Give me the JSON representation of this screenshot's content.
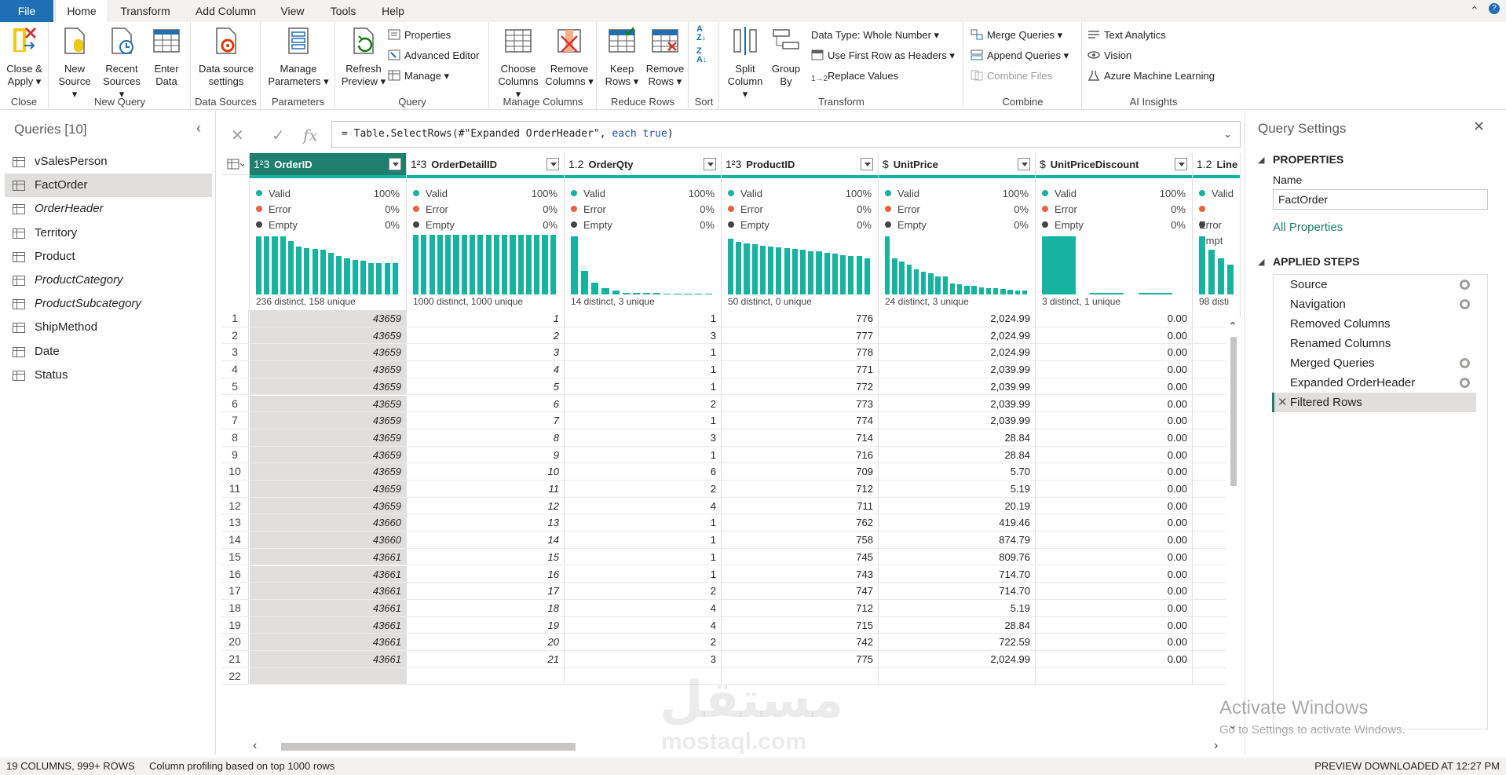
{
  "tabs": [
    "File",
    "Home",
    "Transform",
    "Add Column",
    "View",
    "Tools",
    "Help"
  ],
  "ribbon": {
    "groups": {
      "close": "Close",
      "new_query": "New Query",
      "data_sources": "Data Sources",
      "parameters": "Parameters",
      "query": "Query",
      "manage_columns": "Manage Columns",
      "reduce_rows": "Reduce Rows",
      "sort": "Sort",
      "transform": "Transform",
      "combine": "Combine",
      "ai_insights": "AI Insights"
    },
    "close_apply": [
      "Close &",
      "Apply ▾"
    ],
    "new_source": [
      "New",
      "Source ▾"
    ],
    "recent_sources": [
      "Recent",
      "Sources ▾"
    ],
    "enter_data": [
      "Enter",
      "Data"
    ],
    "data_source_settings": [
      "Data source",
      "settings"
    ],
    "manage_parameters": [
      "Manage",
      "Parameters ▾"
    ],
    "refresh_preview": [
      "Refresh",
      "Preview ▾"
    ],
    "properties": "Properties",
    "advanced_editor": "Advanced Editor",
    "manage": "Manage ▾",
    "choose_columns": [
      "Choose",
      "Columns ▾"
    ],
    "remove_columns": [
      "Remove",
      "Columns ▾"
    ],
    "keep_rows": [
      "Keep",
      "Rows ▾"
    ],
    "remove_rows": [
      "Remove",
      "Rows ▾"
    ],
    "split_column": [
      "Split",
      "Column ▾"
    ],
    "group_by": [
      "Group",
      "By"
    ],
    "data_type": "Data Type: Whole Number ▾",
    "use_first_row": "Use First Row as Headers ▾",
    "replace_values": "Replace Values",
    "merge_queries": "Merge Queries ▾",
    "append_queries": "Append Queries ▾",
    "combine_files": "Combine Files",
    "text_analytics": "Text Analytics",
    "vision": "Vision",
    "azure_ml": "Azure Machine Learning"
  },
  "queries": {
    "title": "Queries [10]",
    "items": [
      {
        "name": "vSalesPerson",
        "italic": false
      },
      {
        "name": "FactOrder",
        "italic": false,
        "selected": true
      },
      {
        "name": "OrderHeader",
        "italic": true
      },
      {
        "name": "Territory",
        "italic": false
      },
      {
        "name": "Product",
        "italic": false
      },
      {
        "name": "ProductCategory",
        "italic": true
      },
      {
        "name": "ProductSubcategory",
        "italic": true
      },
      {
        "name": "ShipMethod",
        "italic": false
      },
      {
        "name": "Date",
        "italic": false
      },
      {
        "name": "Status",
        "italic": false
      }
    ]
  },
  "formula": {
    "prefix": "= Table.SelectRows(#\"Expanded OrderHeader\", ",
    "kw": "each true",
    "suffix": ")"
  },
  "columns": [
    {
      "type": "1²3",
      "name": "OrderID",
      "valid": "100%",
      "error": "0%",
      "empty": "0%",
      "footer": "236 distinct, 158 unique",
      "hist": [
        0.98,
        0.98,
        0.98,
        0.98,
        0.9,
        0.8,
        0.78,
        0.76,
        0.75,
        0.7,
        0.65,
        0.6,
        0.58,
        0.56,
        0.53,
        0.52,
        0.52,
        0.52
      ]
    },
    {
      "type": "1²3",
      "name": "OrderDetailID",
      "valid": "100%",
      "error": "0%",
      "empty": "0%",
      "footer": "1000 distinct, 1000 unique",
      "hist": [
        1,
        1,
        1,
        1,
        1,
        1,
        1,
        1,
        1,
        1,
        1,
        1,
        1,
        1,
        1,
        1,
        1,
        1
      ]
    },
    {
      "type": "1.2",
      "name": "OrderQty",
      "valid": "100%",
      "error": "0%",
      "empty": "0%",
      "footer": "14 distinct, 3 unique",
      "hist": [
        0.98,
        0.4,
        0.2,
        0.1,
        0.06,
        0.03,
        0.02,
        0.02,
        0.02,
        0.01,
        0.01,
        0.01,
        0.01,
        0.01
      ]
    },
    {
      "type": "1²3",
      "name": "ProductID",
      "valid": "100%",
      "error": "0%",
      "empty": "0%",
      "footer": "50 distinct, 0 unique",
      "hist": [
        0.93,
        0.88,
        0.85,
        0.84,
        0.82,
        0.8,
        0.79,
        0.78,
        0.76,
        0.75,
        0.73,
        0.72,
        0.7,
        0.69,
        0.66,
        0.65,
        0.64,
        0.6
      ]
    },
    {
      "type": "$",
      "name": "UnitPrice",
      "valid": "100%",
      "error": "0%",
      "empty": "0%",
      "footer": "24 distinct, 3 unique",
      "hist": [
        0.98,
        0.6,
        0.55,
        0.5,
        0.42,
        0.38,
        0.35,
        0.3,
        0.3,
        0.18,
        0.17,
        0.15,
        0.14,
        0.12,
        0.11,
        0.1,
        0.09,
        0.08,
        0.07,
        0.06
      ]
    },
    {
      "type": "$",
      "name": "UnitPriceDiscount",
      "valid": "100%",
      "error": "0%",
      "empty": "0%",
      "footer": "3 distinct, 1 unique",
      "hist": [
        0.98,
        0.02,
        0.02
      ]
    },
    {
      "type": "1.2",
      "name": "Line",
      "valid": "Valid",
      "error": "Error",
      "empty": "Empt",
      "footer": "98 disti",
      "hist": [
        0.98,
        0.75,
        0.6,
        0.5
      ]
    }
  ],
  "rows": [
    [
      "43659",
      "1",
      "1",
      "776",
      "2,024.99",
      "0.00"
    ],
    [
      "43659",
      "2",
      "3",
      "777",
      "2,024.99",
      "0.00"
    ],
    [
      "43659",
      "3",
      "1",
      "778",
      "2,024.99",
      "0.00"
    ],
    [
      "43659",
      "4",
      "1",
      "771",
      "2,039.99",
      "0.00"
    ],
    [
      "43659",
      "5",
      "1",
      "772",
      "2,039.99",
      "0.00"
    ],
    [
      "43659",
      "6",
      "2",
      "773",
      "2,039.99",
      "0.00"
    ],
    [
      "43659",
      "7",
      "1",
      "774",
      "2,039.99",
      "0.00"
    ],
    [
      "43659",
      "8",
      "3",
      "714",
      "28.84",
      "0.00"
    ],
    [
      "43659",
      "9",
      "1",
      "716",
      "28.84",
      "0.00"
    ],
    [
      "43659",
      "10",
      "6",
      "709",
      "5.70",
      "0.00"
    ],
    [
      "43659",
      "11",
      "2",
      "712",
      "5.19",
      "0.00"
    ],
    [
      "43659",
      "12",
      "4",
      "711",
      "20.19",
      "0.00"
    ],
    [
      "43660",
      "13",
      "1",
      "762",
      "419.46",
      "0.00"
    ],
    [
      "43660",
      "14",
      "1",
      "758",
      "874.79",
      "0.00"
    ],
    [
      "43661",
      "15",
      "1",
      "745",
      "809.76",
      "0.00"
    ],
    [
      "43661",
      "16",
      "1",
      "743",
      "714.70",
      "0.00"
    ],
    [
      "43661",
      "17",
      "2",
      "747",
      "714.70",
      "0.00"
    ],
    [
      "43661",
      "18",
      "4",
      "712",
      "5.19",
      "0.00"
    ],
    [
      "43661",
      "19",
      "4",
      "715",
      "28.84",
      "0.00"
    ],
    [
      "43661",
      "20",
      "2",
      "742",
      "722.59",
      "0.00"
    ],
    [
      "43661",
      "21",
      "3",
      "775",
      "2,024.99",
      "0.00"
    ],
    [
      "",
      "",
      "",
      "",
      "",
      ""
    ]
  ],
  "settings": {
    "title": "Query Settings",
    "properties_header": "PROPERTIES",
    "name_label": "Name",
    "name_value": "FactOrder",
    "all_properties": "All Properties",
    "steps_header": "APPLIED STEPS",
    "steps": [
      {
        "label": "Source",
        "gear": true
      },
      {
        "label": "Navigation",
        "gear": true
      },
      {
        "label": "Removed Columns",
        "gear": false
      },
      {
        "label": "Renamed Columns",
        "gear": false
      },
      {
        "label": "Merged Queries",
        "gear": true
      },
      {
        "label": "Expanded OrderHeader",
        "gear": true
      },
      {
        "label": "Filtered Rows",
        "gear": false,
        "selected": true
      }
    ]
  },
  "status": {
    "columns_rows": "19 COLUMNS, 999+ ROWS",
    "profiling": "Column profiling based on top 1000 rows",
    "preview": "PREVIEW DOWNLOADED AT 12:27 PM"
  },
  "watermark": {
    "line1": "Activate Windows",
    "line2": "Go to Settings to activate Windows.",
    "brand_latin": "mostaql.com",
    "brand_arabic": "مستقل"
  },
  "colors": {
    "accent": "#1e7f6e",
    "teal": "#16b3a0",
    "file_tab": "#1f6fb5",
    "error_dot": "#e8623c"
  }
}
